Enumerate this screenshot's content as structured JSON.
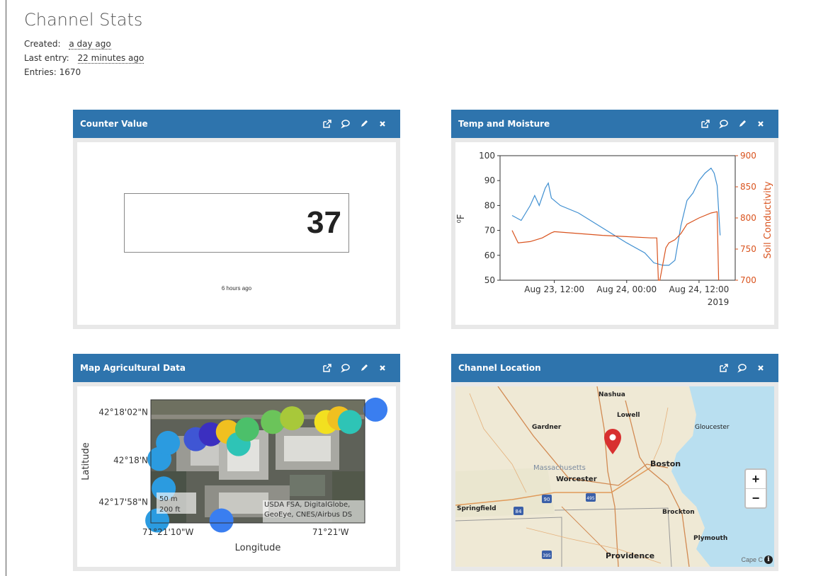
{
  "page": {
    "title": "Channel Stats",
    "created_label": "Created:",
    "created_value": "a day ago",
    "last_entry_label": "Last entry:",
    "last_entry_value": "22 minutes ago",
    "entries_label": "Entries: 1670"
  },
  "widgets": {
    "counter": {
      "title": "Counter Value",
      "value": "37",
      "time": "6 hours ago"
    },
    "temp": {
      "title": "Temp and Moisture"
    },
    "map": {
      "title": "Map Agricultural Data"
    },
    "location": {
      "title": "Channel Location",
      "zoom_in": "+",
      "zoom_out": "−",
      "attribution": "Cape C",
      "info": "i",
      "places": [
        "Nashua",
        "Lowell",
        "Gardner",
        "Gloucester",
        "Massachusetts",
        "Worcester",
        "Boston",
        "Springfield",
        "Brockton",
        "Plymouth",
        "Providence"
      ],
      "shields": [
        "90",
        "495",
        "84",
        "395"
      ]
    }
  },
  "colors": {
    "header": "#2e74ad",
    "temp_line": "#3f8fd1",
    "conductivity_line": "#d9531e",
    "pin": "#d83030"
  },
  "chart_data": [
    {
      "type": "line",
      "title": "",
      "xlabel": "",
      "ylabel": "⁰F",
      "y2label": "Soil Conductivity",
      "ylim": [
        50,
        100
      ],
      "y2lim": [
        700,
        900
      ],
      "yticks": [
        "50",
        "60",
        "70",
        "80",
        "90",
        "100"
      ],
      "y2ticks": [
        "700",
        "750",
        "800",
        "850",
        "900"
      ],
      "xticks": [
        "Aug 23, 12:00",
        "Aug 24, 00:00",
        "Aug 24, 12:00"
      ],
      "xtick_sub": "2019",
      "xlim": [
        "2019-08-23 03:00",
        "2019-08-24 18:00"
      ],
      "series": [
        {
          "axis": "left",
          "x": [
            "2019-08-23 05:00",
            "2019-08-23 06:30",
            "2019-08-23 08:00",
            "2019-08-23 08:45",
            "2019-08-23 09:30",
            "2019-08-23 10:30",
            "2019-08-23 11:00",
            "2019-08-23 11:30",
            "2019-08-23 13:00",
            "2019-08-23 16:00",
            "2019-08-23 20:00",
            "2019-08-24 00:00",
            "2019-08-24 03:00",
            "2019-08-24 04:30",
            "2019-08-24 06:00",
            "2019-08-24 07:00",
            "2019-08-24 08:00",
            "2019-08-24 09:00",
            "2019-08-24 10:00",
            "2019-08-24 11:00",
            "2019-08-24 12:00",
            "2019-08-24 13:00",
            "2019-08-24 14:00",
            "2019-08-24 14:30",
            "2019-08-24 15:00",
            "2019-08-24 15:30"
          ],
          "values": [
            76,
            74,
            80,
            84,
            80,
            87,
            89,
            83,
            80,
            77,
            71,
            65,
            61,
            57,
            56,
            56,
            58,
            72,
            82,
            85,
            90,
            93,
            95,
            93,
            88,
            68
          ]
        },
        {
          "axis": "right",
          "x": [
            "2019-08-23 05:00",
            "2019-08-23 06:00",
            "2019-08-23 08:00",
            "2019-08-23 10:00",
            "2019-08-23 11:30",
            "2019-08-23 12:00",
            "2019-08-23 16:00",
            "2019-08-23 20:00",
            "2019-08-24 00:00",
            "2019-08-24 04:00",
            "2019-08-24 05:00",
            "2019-08-24 05:15",
            "2019-08-24 05:30",
            "2019-08-24 06:30",
            "2019-08-24 07:00",
            "2019-08-24 08:00",
            "2019-08-24 09:00",
            "2019-08-24 10:00",
            "2019-08-24 12:00",
            "2019-08-24 14:00",
            "2019-08-24 15:00",
            "2019-08-24 15:15"
          ],
          "values": [
            780,
            760,
            762,
            768,
            776,
            778,
            775,
            772,
            770,
            768,
            768,
            700,
            700,
            752,
            760,
            765,
            775,
            790,
            800,
            808,
            810,
            700
          ]
        }
      ]
    },
    {
      "type": "scatter",
      "title": "",
      "xlabel": "Longitude",
      "ylabel": "Latitude",
      "xticks": [
        "71°21'10\"W",
        "71°21'W"
      ],
      "yticks": [
        "42°18'02\"N",
        "42°18'N",
        "42°17'58\"N"
      ],
      "scale_labels": [
        "50 m",
        "200 ft"
      ],
      "attribution": "USDA FSA, DigitalGlobe, GeoEye, CNES/Airbus DS",
      "points": [
        {
          "x": 0.06,
          "y": 0.72,
          "color": "#2b9be0"
        },
        {
          "x": 0.04,
          "y": 0.48,
          "color": "#2b9be0"
        },
        {
          "x": 0.08,
          "y": 0.35,
          "color": "#2b9be0"
        },
        {
          "x": 0.03,
          "y": 0.98,
          "color": "#2b9be0"
        },
        {
          "x": 0.21,
          "y": 0.32,
          "color": "#3f56d4"
        },
        {
          "x": 0.28,
          "y": 0.28,
          "color": "#3b2fc0"
        },
        {
          "x": 0.36,
          "y": 0.26,
          "color": "#f0c020"
        },
        {
          "x": 0.41,
          "y": 0.36,
          "color": "#2ec4b6"
        },
        {
          "x": 0.45,
          "y": 0.24,
          "color": "#4cc06a"
        },
        {
          "x": 0.57,
          "y": 0.18,
          "color": "#6bc45a"
        },
        {
          "x": 0.66,
          "y": 0.15,
          "color": "#a8c83a"
        },
        {
          "x": 0.82,
          "y": 0.18,
          "color": "#f2e020"
        },
        {
          "x": 0.88,
          "y": 0.15,
          "color": "#f0c020"
        },
        {
          "x": 0.93,
          "y": 0.18,
          "color": "#2ec4b6"
        },
        {
          "x": 1.05,
          "y": 0.08,
          "color": "#3a7ef0"
        },
        {
          "x": 0.33,
          "y": 0.98,
          "color": "#3a7ef0"
        }
      ]
    }
  ]
}
